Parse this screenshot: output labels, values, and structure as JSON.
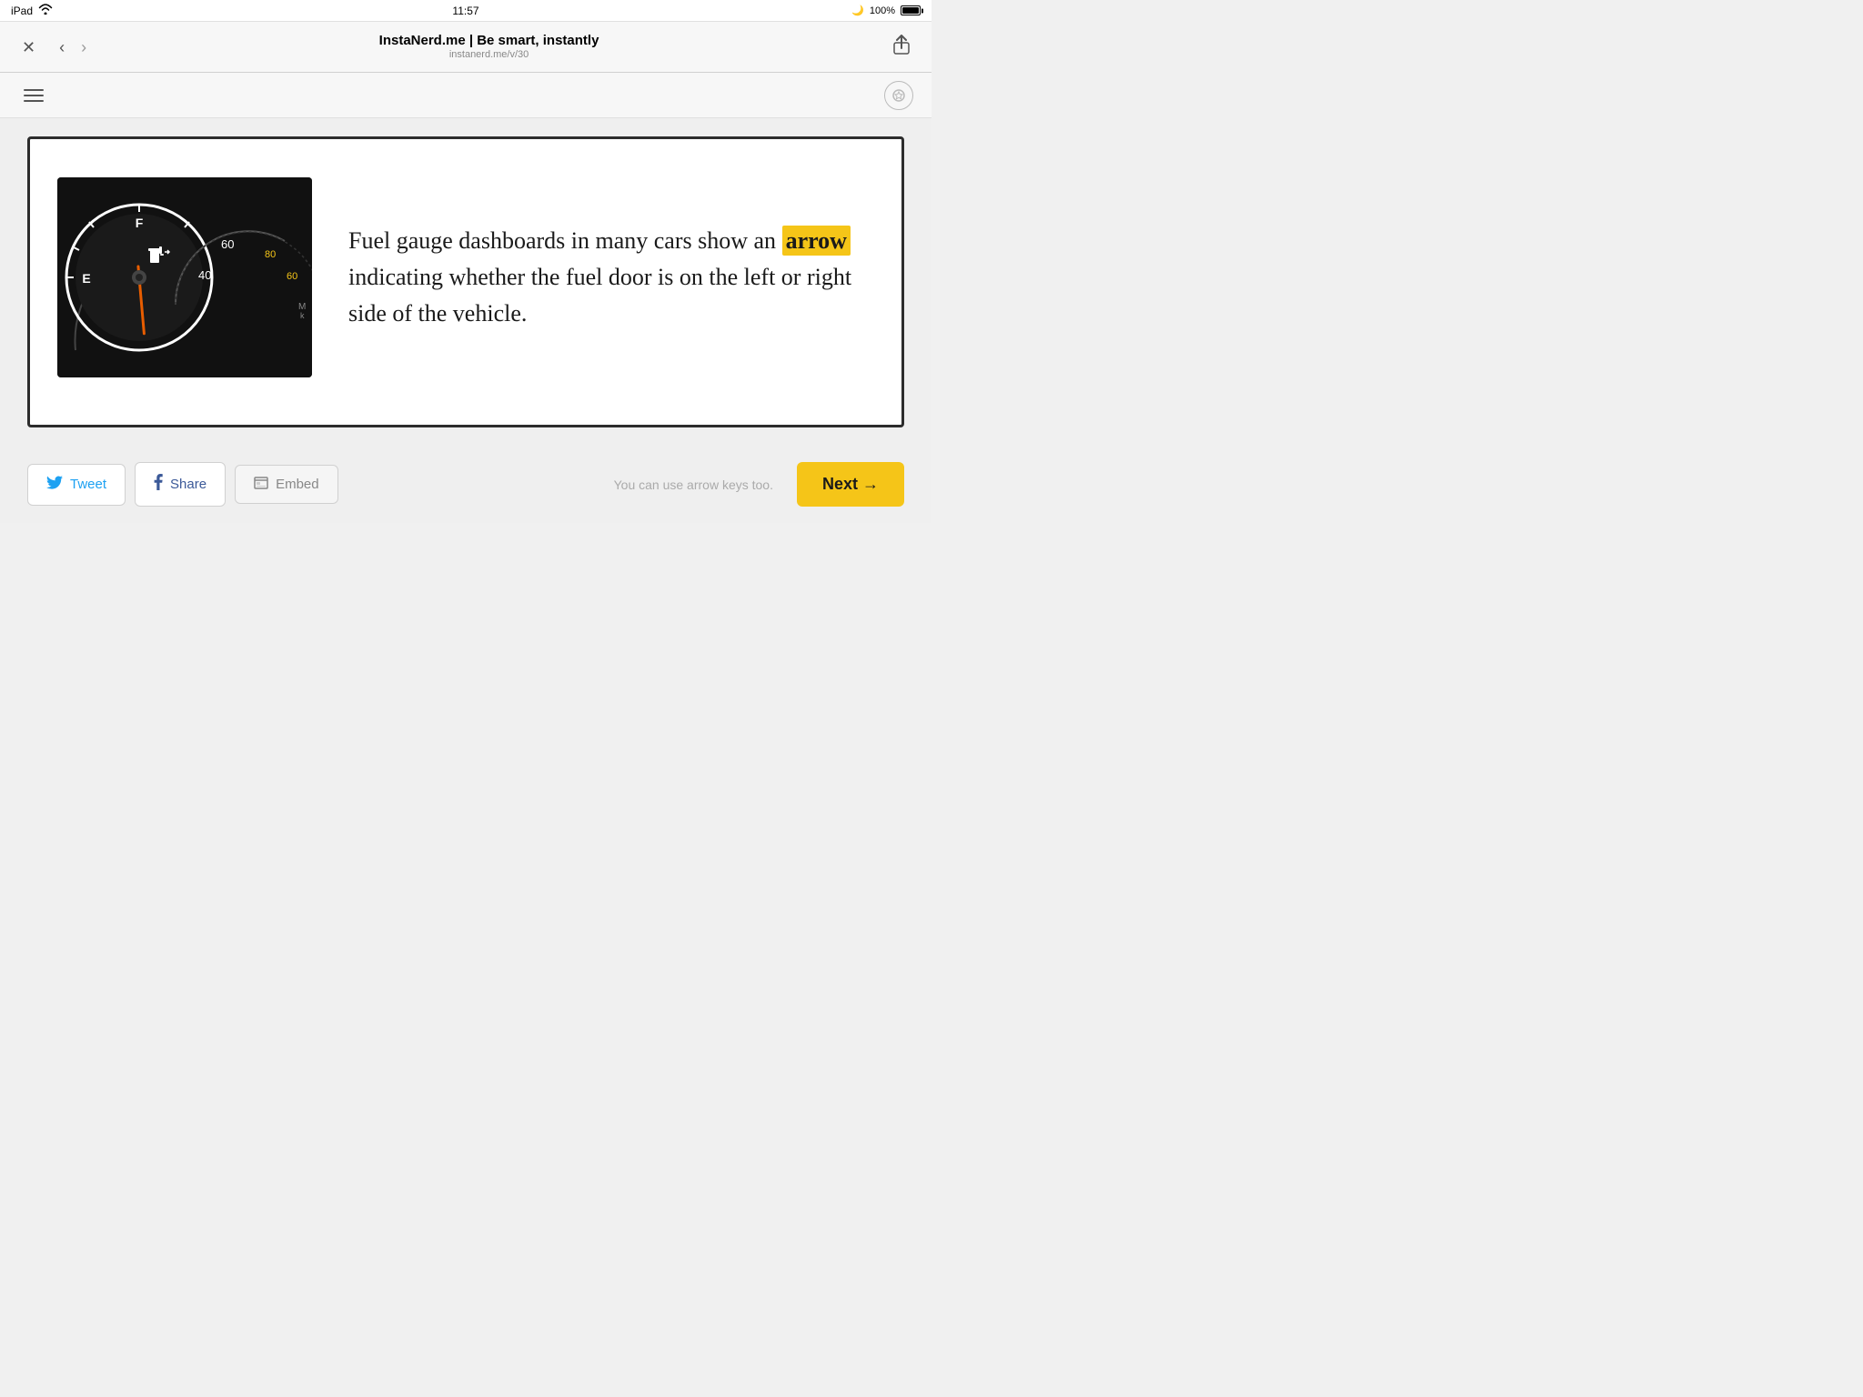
{
  "status_bar": {
    "device": "iPad",
    "wifi": "wifi",
    "time": "11:57",
    "moon": "🌙",
    "battery_pct": "100%"
  },
  "browser": {
    "title": "InstaNerd.me | Be smart, instantly",
    "url": "instanerd.me/v/30"
  },
  "toolbar": {
    "menu_label": "menu",
    "star_label": "★"
  },
  "card": {
    "text_before": "Fuel gauge dashboards in many cars show an ",
    "highlight": "arrow",
    "text_after": " indicating whether the fuel door is on the left or right side of the vehicle."
  },
  "actions": {
    "tweet_label": "Tweet",
    "share_label": "Share",
    "embed_label": "Embed",
    "arrow_hint": "You can use arrow keys too.",
    "next_label": "Next →"
  }
}
